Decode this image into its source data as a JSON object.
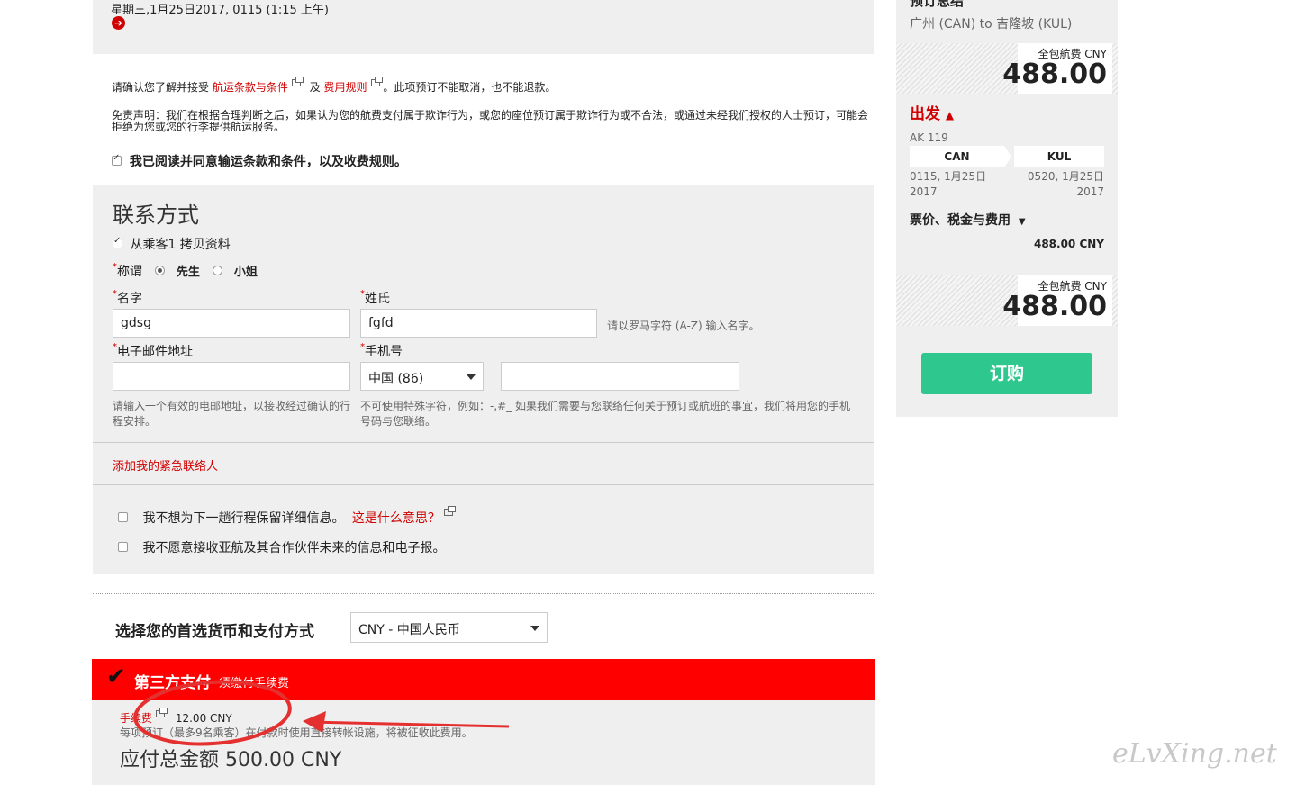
{
  "flight_date": "星期三,1月25日2017, 0115 (1:15 上午)",
  "terms": {
    "prefix": "请确认您了解并接受",
    "link1": "航运条款与条件",
    "and": "及",
    "link2": "费用规则",
    "suffix": "。此项预订不能取消，也不能退款。",
    "disclaimer": "免责声明：我们在根据合理判断之后，如果认为您的航费支付属于欺诈行为，或您的座位预订属于欺诈行为或不合法，或通过未经我们授权的人士预订，可能会拒绝为您或您的行李提供航运服务。",
    "agree_label": "我已阅读并同意输运条款和条件，以及收费规则。"
  },
  "contact": {
    "title": "联系方式",
    "copy_label": "从乘客1 拷贝资料",
    "salutation_label": "称谓",
    "mr": "先生",
    "ms": "小姐",
    "first_name_label": "名字",
    "first_name_value": "gdsg",
    "last_name_label": "姓氏",
    "last_name_value": "fgfd",
    "name_hint": "请以罗马字符 (A-Z) 输入名字。",
    "email_label": "电子邮件地址",
    "email_value": "",
    "phone_label": "手机号",
    "country_code": "中国 (86)",
    "phone_value": "",
    "email_hint": "请输入一个有效的电邮地址，以接收经过确认的行程安排。",
    "phone_hint": "不可使用特殊字符，例如：-,#_ 如果我们需要与您联络任何关于预订或航班的事宜，我们将用您的手机号码与您联络。",
    "emergency_link": "添加我的紧急联络人"
  },
  "options": {
    "opt1": "我不想为下一趟行程保留详细信息。",
    "opt1_link": "这是什么意思？",
    "opt2": "我不愿意接收亚航及其合作伙伴未来的信息和电子报。"
  },
  "payment": {
    "label": "选择您的首选货币和支付方式",
    "currency": "CNY - 中国人民币",
    "method_title": "第三方支付",
    "method_note": "须缴付手续费",
    "fee_label": "手续费",
    "fee_value": "12.00 CNY",
    "fee_desc": "每项预订（最多9名乘客）在付款时使用直接转帐设施，将被征收此费用。",
    "total_label": "应付总金额",
    "total_value": "500.00 CNY"
  },
  "summary": {
    "title": "预订总结",
    "route": "广州 (CAN) to 吉隆坡 (KUL)",
    "all_in_label": "全包航费 CNY",
    "all_in_value": "488.00",
    "depart_label": "出发",
    "flight_no": "AK 119",
    "from_code": "CAN",
    "to_code": "KUL",
    "depart_time": "0115, 1月25日 2017",
    "arrive_time": "0520, 1月25日 2017",
    "fare_label": "票价、税金与费用",
    "fare_value": "488.00 CNY",
    "all_in_label2": "全包航费 CNY",
    "all_in_value2": "488.00",
    "book_button": "订购"
  },
  "watermark": "eLvXing.net",
  "colors": {
    "brand_red": "#ff0000",
    "link_red": "#d10000",
    "book_green": "#2ec88e"
  }
}
